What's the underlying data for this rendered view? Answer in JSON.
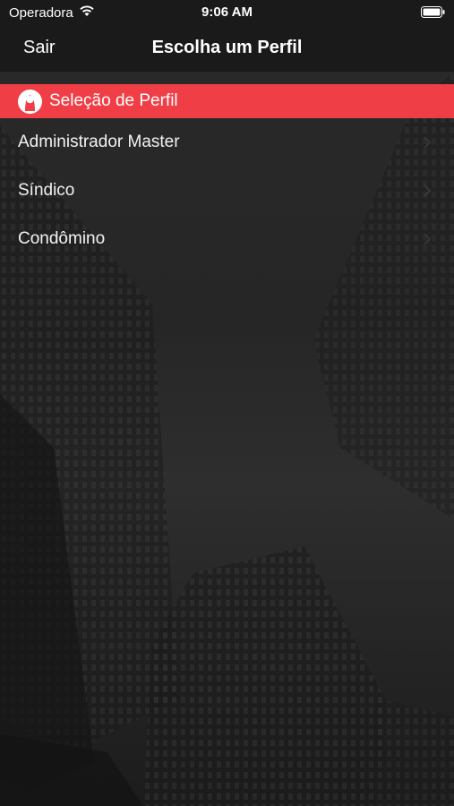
{
  "status_bar": {
    "carrier": "Operadora",
    "time": "9:06 AM",
    "icons": [
      "wifi-icon",
      "battery-icon"
    ]
  },
  "nav_bar": {
    "back_label": "Sair",
    "title": "Escolha um Perfil"
  },
  "section": {
    "title": "Seleção de Perfil",
    "icon": "user-profile-icon",
    "color": "#ef3e46"
  },
  "profiles": [
    {
      "label": "Administrador Master"
    },
    {
      "label": "Síndico"
    },
    {
      "label": "Condômino"
    }
  ],
  "colors": {
    "accent": "#ef3e46",
    "bar_background": "#1a1a1a",
    "text": "#ffffff"
  }
}
